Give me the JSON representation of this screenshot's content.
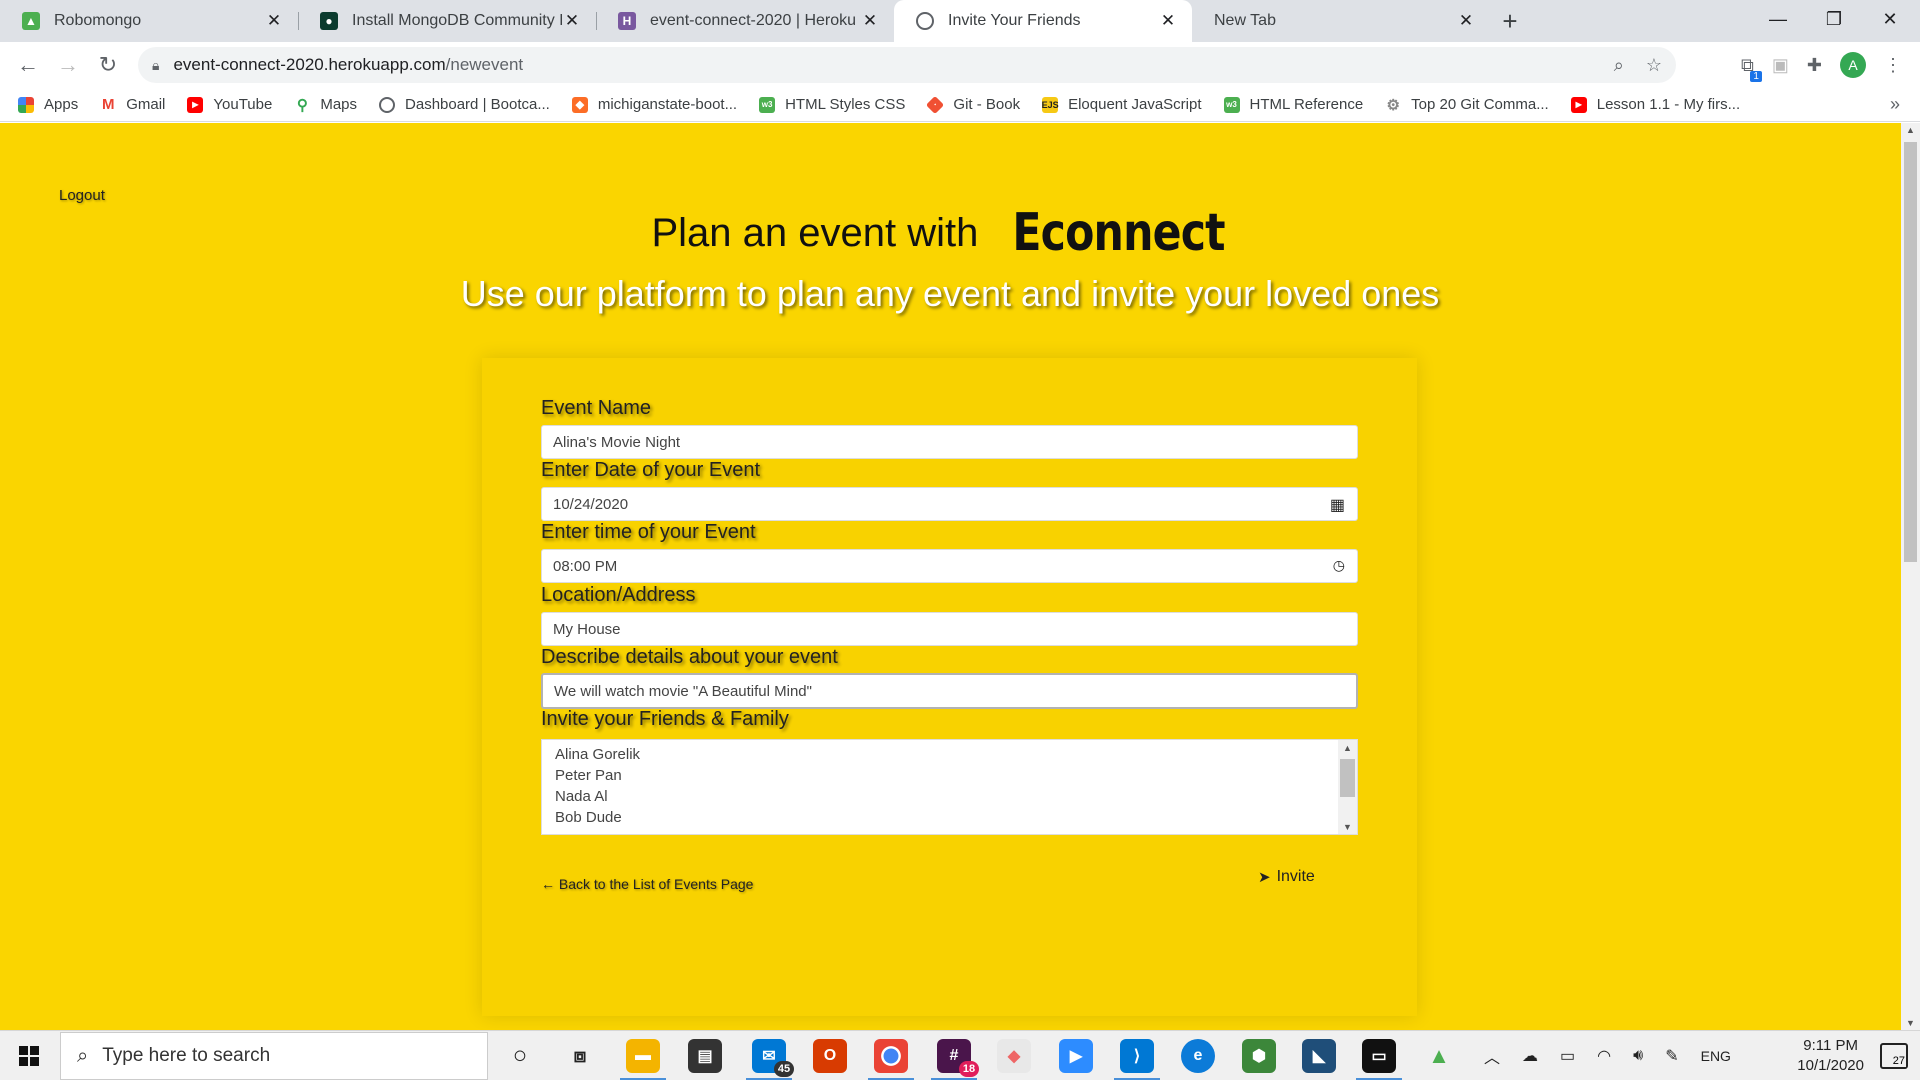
{
  "browser": {
    "tabs": [
      {
        "label": "Robomongo",
        "icon": "robomongo-icon",
        "color": "#4caf50",
        "active": false
      },
      {
        "label": "Install MongoDB Community Edi",
        "icon": "mongodb-icon",
        "color": "#13aa52",
        "active": false
      },
      {
        "label": "event-connect-2020 | Heroku",
        "icon": "heroku-icon",
        "color": "#79589f",
        "active": false
      },
      {
        "label": "Invite Your Friends",
        "icon": "globe-icon",
        "color": "#5f6368",
        "active": true
      },
      {
        "label": "New Tab",
        "icon": "",
        "color": "",
        "active": false
      }
    ],
    "url": {
      "host": "event-connect-2020.herokuapp.com",
      "path": "/newevent"
    },
    "profile_initial": "A",
    "extension_badge": "1",
    "bookmarks": [
      {
        "label": "Apps",
        "icon": "apps-grid-icon",
        "color": "#4285f4"
      },
      {
        "label": "Gmail",
        "icon": "gmail-icon",
        "color": "#ea4335"
      },
      {
        "label": "YouTube",
        "icon": "youtube-icon",
        "color": "#ff0000"
      },
      {
        "label": "Maps",
        "icon": "maps-pin-icon",
        "color": "#34a853"
      },
      {
        "label": "Dashboard | Bootca...",
        "icon": "globe-icon",
        "color": "#5f6368"
      },
      {
        "label": "michiganstate-boot...",
        "icon": "gitlab-icon",
        "color": "#fc6d26"
      },
      {
        "label": "HTML Styles CSS",
        "icon": "w3-icon",
        "color": "#4caf50"
      },
      {
        "label": "Git - Book",
        "icon": "git-icon",
        "color": "#f05033"
      },
      {
        "label": "Eloquent JavaScript",
        "icon": "ejs-icon",
        "color": "#333333"
      },
      {
        "label": "HTML Reference",
        "icon": "w3-icon",
        "color": "#4caf50"
      },
      {
        "label": "Top 20 Git Comma...",
        "icon": "gear-icon",
        "color": "#888888"
      },
      {
        "label": "Lesson 1.1 - My firs...",
        "icon": "youtube-icon",
        "color": "#ff0000"
      }
    ]
  },
  "page": {
    "logout_label": "Logout",
    "title_prefix": "Plan an event with",
    "brand": "Econnect",
    "subtitle": "Use our platform to plan any event and invite your loved ones",
    "form": {
      "event_name": {
        "label": "Event Name",
        "value": "Alina's Movie Night"
      },
      "event_date": {
        "label": "Enter Date of your Event",
        "value": "10/24/2020"
      },
      "event_time": {
        "label": "Enter time of your Event",
        "value": "08:00 PM"
      },
      "location": {
        "label": "Location/Address",
        "value": "My House"
      },
      "details": {
        "label": "Describe details about your event",
        "value": "We will watch movie \"A Beautiful Mind\""
      },
      "invite": {
        "label": "Invite your Friends & Family",
        "options": [
          "Alina Gorelik",
          "Peter Pan",
          "Nada Al",
          "Bob Dude"
        ]
      },
      "back_link": "← Back to the List of Events Page",
      "invite_button": "Invite"
    },
    "accent_color": "#fad500"
  },
  "taskbar": {
    "search_placeholder": "Type here to search",
    "mail_badge": "45",
    "slack_badge": "18",
    "language": "ENG",
    "time": "9:11 PM",
    "date": "10/1/2020",
    "notification_count": "27"
  }
}
